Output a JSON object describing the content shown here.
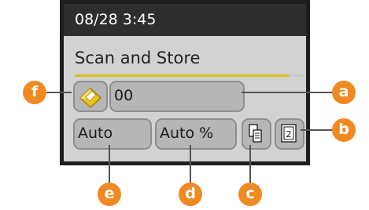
{
  "status_bar": {
    "datetime": "08/28 3:45"
  },
  "mode_title": "Scan and Store",
  "progress": {
    "fraction": 0.93,
    "accent_color": "#d9be1e"
  },
  "destination": {
    "icon": "address-book-icon",
    "value": "00"
  },
  "settings": {
    "resolution": "Auto",
    "zoom": "Auto %",
    "duplex_icon": "two-sided-scan-icon",
    "color_icon": "color-mode-icon"
  },
  "callouts": {
    "a": "a",
    "b": "b",
    "c": "c",
    "d": "d",
    "e": "e",
    "f": "f",
    "color": "#ef8a22"
  }
}
